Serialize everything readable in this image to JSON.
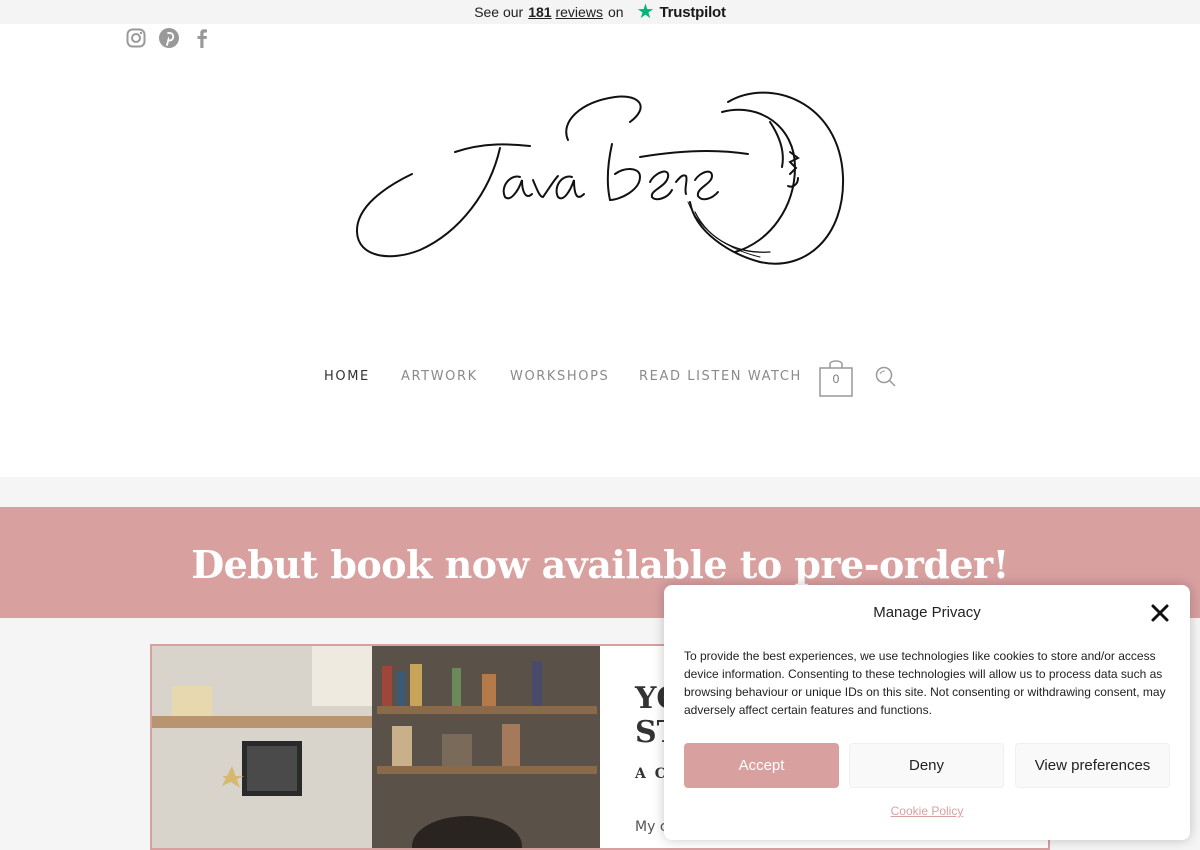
{
  "trustpilot": {
    "prefix": "See our",
    "count": "181",
    "reviews": "reviews",
    "on": "on",
    "brand": "Trustpilot"
  },
  "social_icons": [
    "instagram-icon",
    "pinterest-icon",
    "facebook-icon"
  ],
  "nav": {
    "items": [
      {
        "label": "HOME",
        "active": true
      },
      {
        "label": "ARTWORK",
        "active": false
      },
      {
        "label": "WORKSHOPS",
        "active": false
      },
      {
        "label": "READ LISTEN WATCH",
        "active": false
      }
    ],
    "cart_count": "0"
  },
  "banner": {
    "text": "Debut book now available to pre-order!"
  },
  "content": {
    "heading_line1": "YO",
    "heading_line2": "ST",
    "subheading": "A CA",
    "paragraph": "My c"
  },
  "privacy": {
    "title": "Manage Privacy",
    "body": "To provide the best experiences, we use technologies like cookies to store and/or access device information. Consenting to these technologies will allow us to process data such as browsing behaviour or unique IDs on this site. Not consenting or withdrawing consent, may adversely affect certain features and functions.",
    "accept": "Accept",
    "deny": "Deny",
    "preferences": "View preferences",
    "cookie_policy": "Cookie Policy"
  },
  "colors": {
    "brand_pink": "#d9a0a0",
    "trustpilot_green": "#00b67a"
  }
}
